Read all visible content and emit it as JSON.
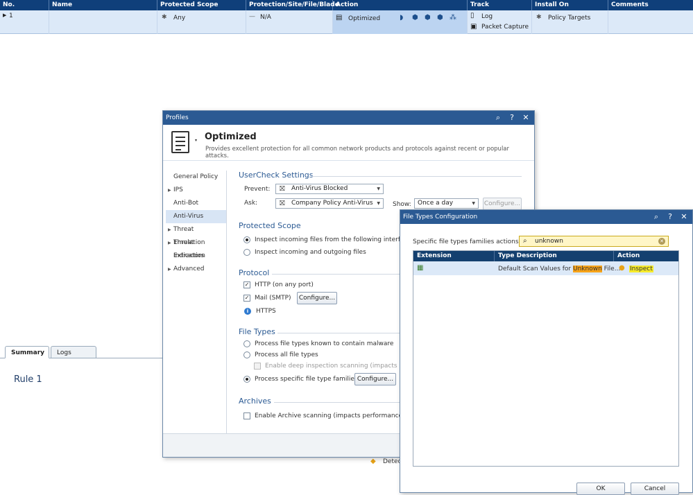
{
  "policy_table": {
    "columns": [
      "No.",
      "Name",
      "Protected Scope",
      "Protection/Site/File/Blade",
      "Action",
      "Track",
      "Install On",
      "Comments"
    ],
    "row": {
      "no": "1",
      "name": "",
      "protected_scope": "Any",
      "protection": "N/A",
      "action": "Optimized",
      "track": [
        "Log",
        "Packet Capture"
      ],
      "install_on": "Policy Targets",
      "comments": ""
    }
  },
  "summary": {
    "tabs": [
      "Summary",
      "Logs"
    ],
    "rule_title": "Rule 1",
    "detect_text": "Detec"
  },
  "profiles": {
    "title": "Profiles",
    "name": "Optimized",
    "description": "Provides excellent protection for all common network products and protocols against recent or popular attacks.",
    "nav": [
      {
        "label": "General Policy",
        "arrow": false
      },
      {
        "label": "IPS",
        "arrow": true
      },
      {
        "label": "Anti-Bot",
        "arrow": false
      },
      {
        "label": "Anti-Virus",
        "arrow": false
      },
      {
        "label": "Threat Emulation",
        "arrow": true
      },
      {
        "label": "Threat Extraction",
        "arrow": true
      },
      {
        "label": "Indicators",
        "arrow": false
      },
      {
        "label": "Advanced",
        "arrow": true
      }
    ],
    "usercheck": {
      "title": "UserCheck Settings",
      "prevent_label": "Prevent:",
      "prevent_value": "Anti-Virus Blocked",
      "ask_label": "Ask:",
      "ask_value": "Company Policy Anti-Virus",
      "show_label": "Show:",
      "show_value": "Once a day",
      "configure": "Configure..."
    },
    "protected_scope": {
      "title": "Protected Scope",
      "opt1": "Inspect incoming files from the following interface",
      "opt2": "Inspect incoming and outgoing files"
    },
    "protocol": {
      "title": "Protocol",
      "http": "HTTP (on any port)",
      "mail": "Mail (SMTP)",
      "configure": "Configure...",
      "https": "HTTPS"
    },
    "file_types": {
      "title": "File Types",
      "opt1": "Process file types known to contain malware",
      "opt2": "Process all file types",
      "deep": "Enable deep inspection scanning (impacts perfo",
      "opt3": "Process specific file type families",
      "configure": "Configure..."
    },
    "archives": {
      "title": "Archives",
      "enable": "Enable Archive scanning (impacts performance)"
    }
  },
  "file_types_dialog": {
    "title": "File Types Configuration",
    "search_label": "Specific file types families actions:",
    "search_value": "unknown",
    "columns": [
      "Extension",
      "Type Description",
      "Action"
    ],
    "row": {
      "desc_prefix": "Default Scan Values for ",
      "desc_highlight": "Unknown",
      "desc_suffix": " File...",
      "action": "Inspect"
    },
    "ok": "OK",
    "cancel": "Cancel"
  },
  "colors": {
    "header_blue": "#0f3f7a",
    "title_blue": "#2b5a93",
    "row_selected": "#dce9f8",
    "highlight_orange": "#f7a318",
    "highlight_yellow": "#f6ea2a"
  }
}
